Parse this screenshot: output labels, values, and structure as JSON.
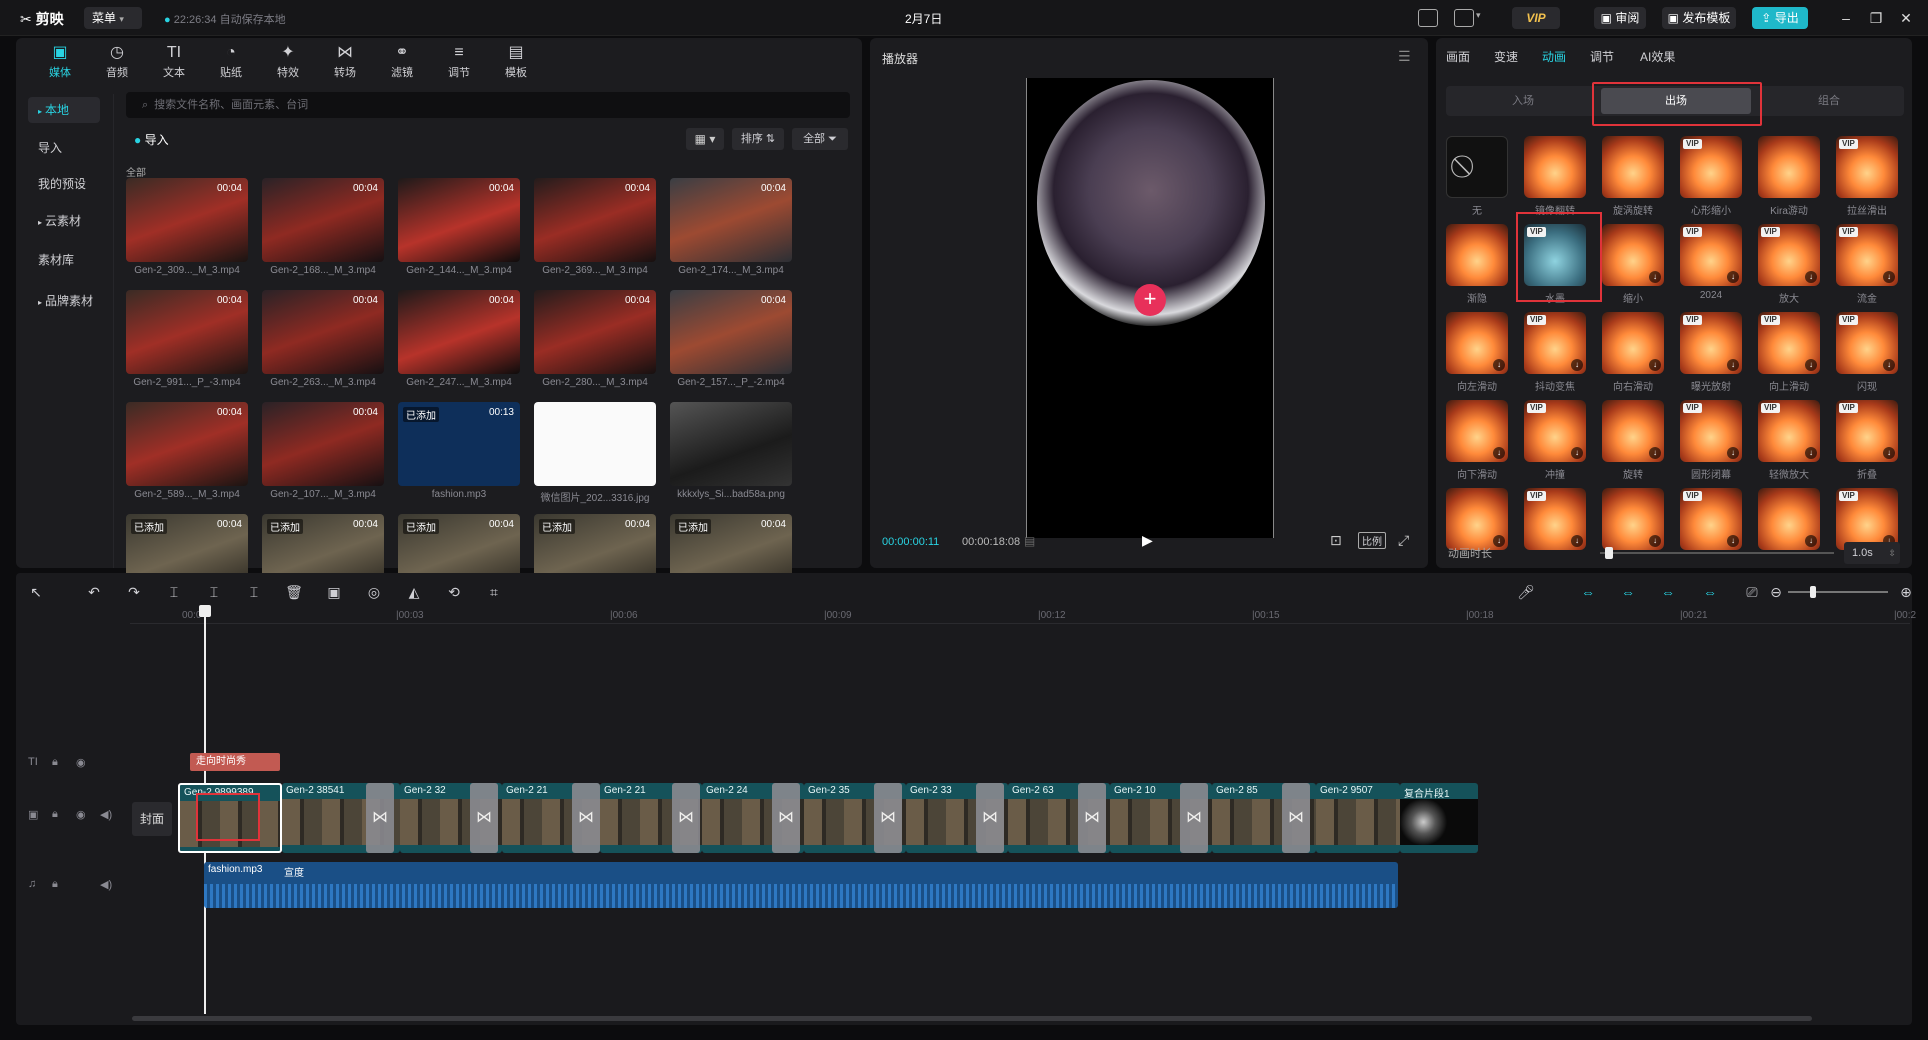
{
  "app": {
    "name": "剪映",
    "menu": "菜单",
    "autosave": "22:26:34 自动保存本地",
    "title": "2月7日",
    "vip": "VIP",
    "review": "审阅",
    "publish_template": "发布模板",
    "export": "导出"
  },
  "media_toolbar": [
    {
      "label": "媒体",
      "icon": "media-icon"
    },
    {
      "label": "音频",
      "icon": "audio-icon"
    },
    {
      "label": "文本",
      "icon": "text-icon"
    },
    {
      "label": "贴纸",
      "icon": "sticker-icon"
    },
    {
      "label": "特效",
      "icon": "effects-icon"
    },
    {
      "label": "转场",
      "icon": "transition-icon"
    },
    {
      "label": "滤镜",
      "icon": "filter-icon"
    },
    {
      "label": "调节",
      "icon": "adjust-icon"
    },
    {
      "label": "模板",
      "icon": "template-icon"
    }
  ],
  "sidebar": [
    "本地",
    "导入",
    "我的预设",
    "云素材",
    "素材库",
    "品牌素材"
  ],
  "search_placeholder": "搜索文件名称、画面元素、台词",
  "import_label": "导入",
  "sort_label": "排序",
  "filter_label": "全部",
  "all_label": "全部",
  "media": [
    {
      "name": "Gen-2_309..._M_3.mp4",
      "dur": "00:04",
      "added": ""
    },
    {
      "name": "Gen-2_168..._M_3.mp4",
      "dur": "00:04",
      "added": ""
    },
    {
      "name": "Gen-2_144..._M_3.mp4",
      "dur": "00:04",
      "added": ""
    },
    {
      "name": "Gen-2_369..._M_3.mp4",
      "dur": "00:04",
      "added": ""
    },
    {
      "name": "Gen-2_174..._M_3.mp4",
      "dur": "00:04",
      "added": ""
    },
    {
      "name": "Gen-2_991..._P_-3.mp4",
      "dur": "00:04",
      "added": ""
    },
    {
      "name": "Gen-2_263..._M_3.mp4",
      "dur": "00:04",
      "added": ""
    },
    {
      "name": "Gen-2_247..._M_3.mp4",
      "dur": "00:04",
      "added": ""
    },
    {
      "name": "Gen-2_280..._M_3.mp4",
      "dur": "00:04",
      "added": ""
    },
    {
      "name": "Gen-2_157..._P_-2.mp4",
      "dur": "00:04",
      "added": ""
    },
    {
      "name": "Gen-2_589..._M_3.mp4",
      "dur": "00:04",
      "added": ""
    },
    {
      "name": "Gen-2_107..._M_3.mp4",
      "dur": "00:04",
      "added": ""
    },
    {
      "name": "fashion.mp3",
      "dur": "00:13",
      "added": "已添加"
    },
    {
      "name": "微信图片_202...3316.jpg",
      "dur": "",
      "added": ""
    },
    {
      "name": "kkkxlys_Si...bad58a.png",
      "dur": "",
      "added": ""
    },
    {
      "name": "",
      "dur": "00:04",
      "added": "已添加"
    },
    {
      "name": "",
      "dur": "00:04",
      "added": "已添加"
    },
    {
      "name": "",
      "dur": "00:04",
      "added": "已添加"
    },
    {
      "name": "",
      "dur": "00:04",
      "added": "已添加"
    },
    {
      "name": "",
      "dur": "00:04",
      "added": "已添加"
    }
  ],
  "player": {
    "title": "播放器",
    "current": "00:00:00:11",
    "total": "00:00:18:08",
    "ratio": "比例"
  },
  "inspector": {
    "tabs": [
      "画面",
      "变速",
      "动画",
      "调节",
      "AI效果"
    ],
    "active_tab": "动画",
    "segments": [
      "入场",
      "出场",
      "组合"
    ],
    "active_segment": "出场",
    "duration_label": "动画时长",
    "duration_value": "1.0s",
    "duration_fraction": 0.02,
    "items": [
      {
        "label": "无",
        "vip": false
      },
      {
        "label": "镜像翻转",
        "vip": false
      },
      {
        "label": "旋涡旋转",
        "vip": false
      },
      {
        "label": "心形缩小",
        "vip": true
      },
      {
        "label": "Kira游动",
        "vip": false
      },
      {
        "label": "拉丝滑出",
        "vip": true
      },
      {
        "label": "渐隐",
        "vip": false
      },
      {
        "label": "水墨",
        "vip": true
      },
      {
        "label": "缩小",
        "vip": false
      },
      {
        "label": "2024",
        "vip": true
      },
      {
        "label": "放大",
        "vip": true
      },
      {
        "label": "流金",
        "vip": true
      },
      {
        "label": "向左滑动",
        "vip": false
      },
      {
        "label": "抖动变焦",
        "vip": true
      },
      {
        "label": "向右滑动",
        "vip": false
      },
      {
        "label": "曝光放射",
        "vip": true
      },
      {
        "label": "向上滑动",
        "vip": true
      },
      {
        "label": "闪现",
        "vip": true
      },
      {
        "label": "向下滑动",
        "vip": false
      },
      {
        "label": "冲撞",
        "vip": true
      },
      {
        "label": "旋转",
        "vip": false
      },
      {
        "label": "圆形闭幕",
        "vip": true
      },
      {
        "label": "轻微放大",
        "vip": true
      },
      {
        "label": "折叠",
        "vip": true
      },
      {
        "label": "",
        "vip": false
      },
      {
        "label": "",
        "vip": true
      },
      {
        "label": "",
        "vip": false
      },
      {
        "label": "",
        "vip": true
      },
      {
        "label": "",
        "vip": false
      },
      {
        "label": "",
        "vip": true
      }
    ]
  },
  "timeline": {
    "ruler": [
      "00:0",
      "|00:03",
      "|00:06",
      "|00:09",
      "|00:12",
      "|00:15",
      "|00:18",
      "|00:21",
      "|00:2"
    ],
    "text_clip": "走向时尚秀",
    "cover": "封面",
    "clips": [
      "Gen-2 9899389",
      "Gen-2 38541",
      "Gen-2 32",
      "Gen-2 21",
      "Gen-2 21",
      "Gen-2 24",
      "Gen-2 35",
      "Gen-2 33",
      "Gen-2 63",
      "Gen-2 10",
      "Gen-2 85",
      "Gen-2 9507",
      "复合片段1"
    ],
    "audio": {
      "name": "fashion.mp3",
      "name2": "宣度"
    }
  },
  "colors": {
    "accent": "#29d3e2",
    "highlight_red": "#e0333a"
  }
}
